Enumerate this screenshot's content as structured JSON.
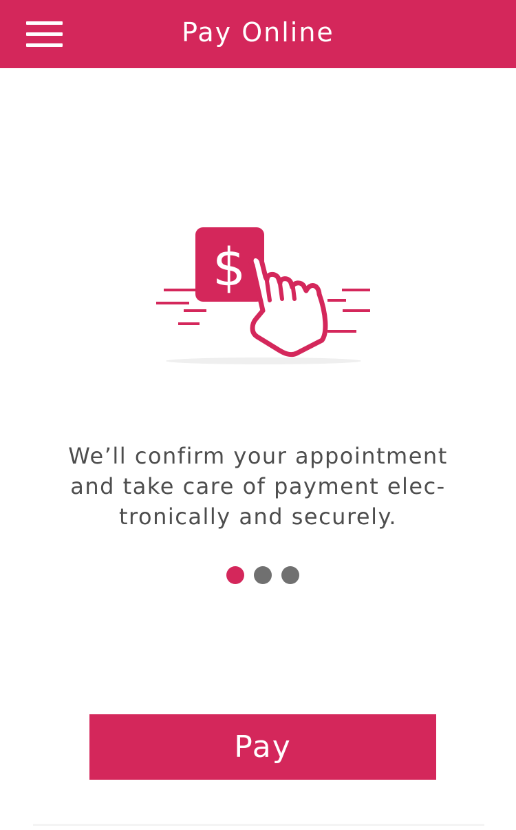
{
  "header": {
    "title": "Pay Online",
    "menu_icon": "hamburger-menu-icon"
  },
  "illustration": {
    "icon": "pay-tap-icon",
    "symbol": "$"
  },
  "onboarding": {
    "message": "We’ll confirm your appointment\nand take care of payment elec-\ntronically and securely.",
    "pagination": {
      "total": 3,
      "current": 1
    }
  },
  "actions": {
    "pay_label": "Pay"
  },
  "colors": {
    "accent": "#d4275b",
    "dot_inactive": "#707070",
    "text": "#4d4d4d",
    "background": "#ffffff"
  }
}
